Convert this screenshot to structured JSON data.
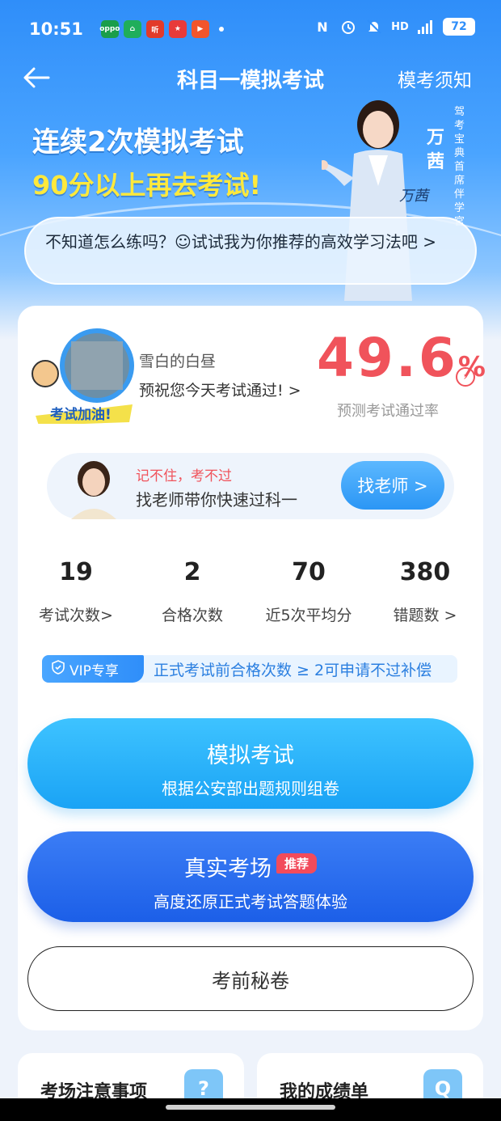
{
  "status_bar": {
    "time": "10:51",
    "apps": [
      {
        "icon": "oppo-app-icon",
        "label": "oppo",
        "color": "#1a9e4a"
      },
      {
        "icon": "home-app-icon",
        "label": "⌂",
        "color": "#1fae5b"
      },
      {
        "icon": "listen-app-icon",
        "label": "听",
        "color": "#e23a2a"
      },
      {
        "icon": "food-app-icon",
        "label": "★",
        "color": "#e83a3a"
      },
      {
        "icon": "video-app-icon",
        "label": "▶",
        "color": "#f2552c"
      }
    ],
    "nfc": "N",
    "hd": "HD",
    "network": "5G",
    "battery": "72"
  },
  "nav": {
    "title": "科目一模拟考试",
    "notice": "模考须知"
  },
  "hero": {
    "line1": "连续2次模拟考试",
    "line2": "90分以上再去考试!",
    "presenter_name": "万茜",
    "presenter_title": "驾考宝典首席伴学官",
    "signature": "万茜",
    "tip": "不知道怎么练吗？☺试试我为你推荐的高效学习法吧 >"
  },
  "profile": {
    "badge_text": "考试加油!",
    "user_name": "雪白的白昼",
    "wish": "预祝您今天考试通过!  >",
    "pass_rate_value": "49.6",
    "pass_rate_unit": "%",
    "pass_rate_label": "预测考试通过率"
  },
  "teacher": {
    "tag": "记不住，考不过",
    "desc": "找老师带你快速过科一",
    "button": "找老师 >"
  },
  "stats": [
    {
      "value": "19",
      "label": "考试次数>"
    },
    {
      "value": "2",
      "label": "合格次数"
    },
    {
      "value": "70",
      "label": "近5次平均分"
    },
    {
      "value": "380",
      "label": "错题数 >"
    }
  ],
  "vip": {
    "tag": "VIP专享",
    "text": "正式考试前合格次数 ≥ 2可申请不过补偿"
  },
  "buttons": {
    "mock_title": "模拟考试",
    "mock_sub": "根据公安部出题规则组卷",
    "real_title": "真实考场",
    "real_badge": "推荐",
    "real_sub": "高度还原正式考试答题体验",
    "secret": "考前秘卷"
  },
  "tiles": [
    {
      "label": "考场注意事项",
      "icon": "?"
    },
    {
      "label": "我的成绩单",
      "icon": "Q"
    }
  ],
  "colors": {
    "primary_blue": "#2f8ef9",
    "accent_red": "#f0535b",
    "highlight_yellow": "#ffe93c"
  }
}
